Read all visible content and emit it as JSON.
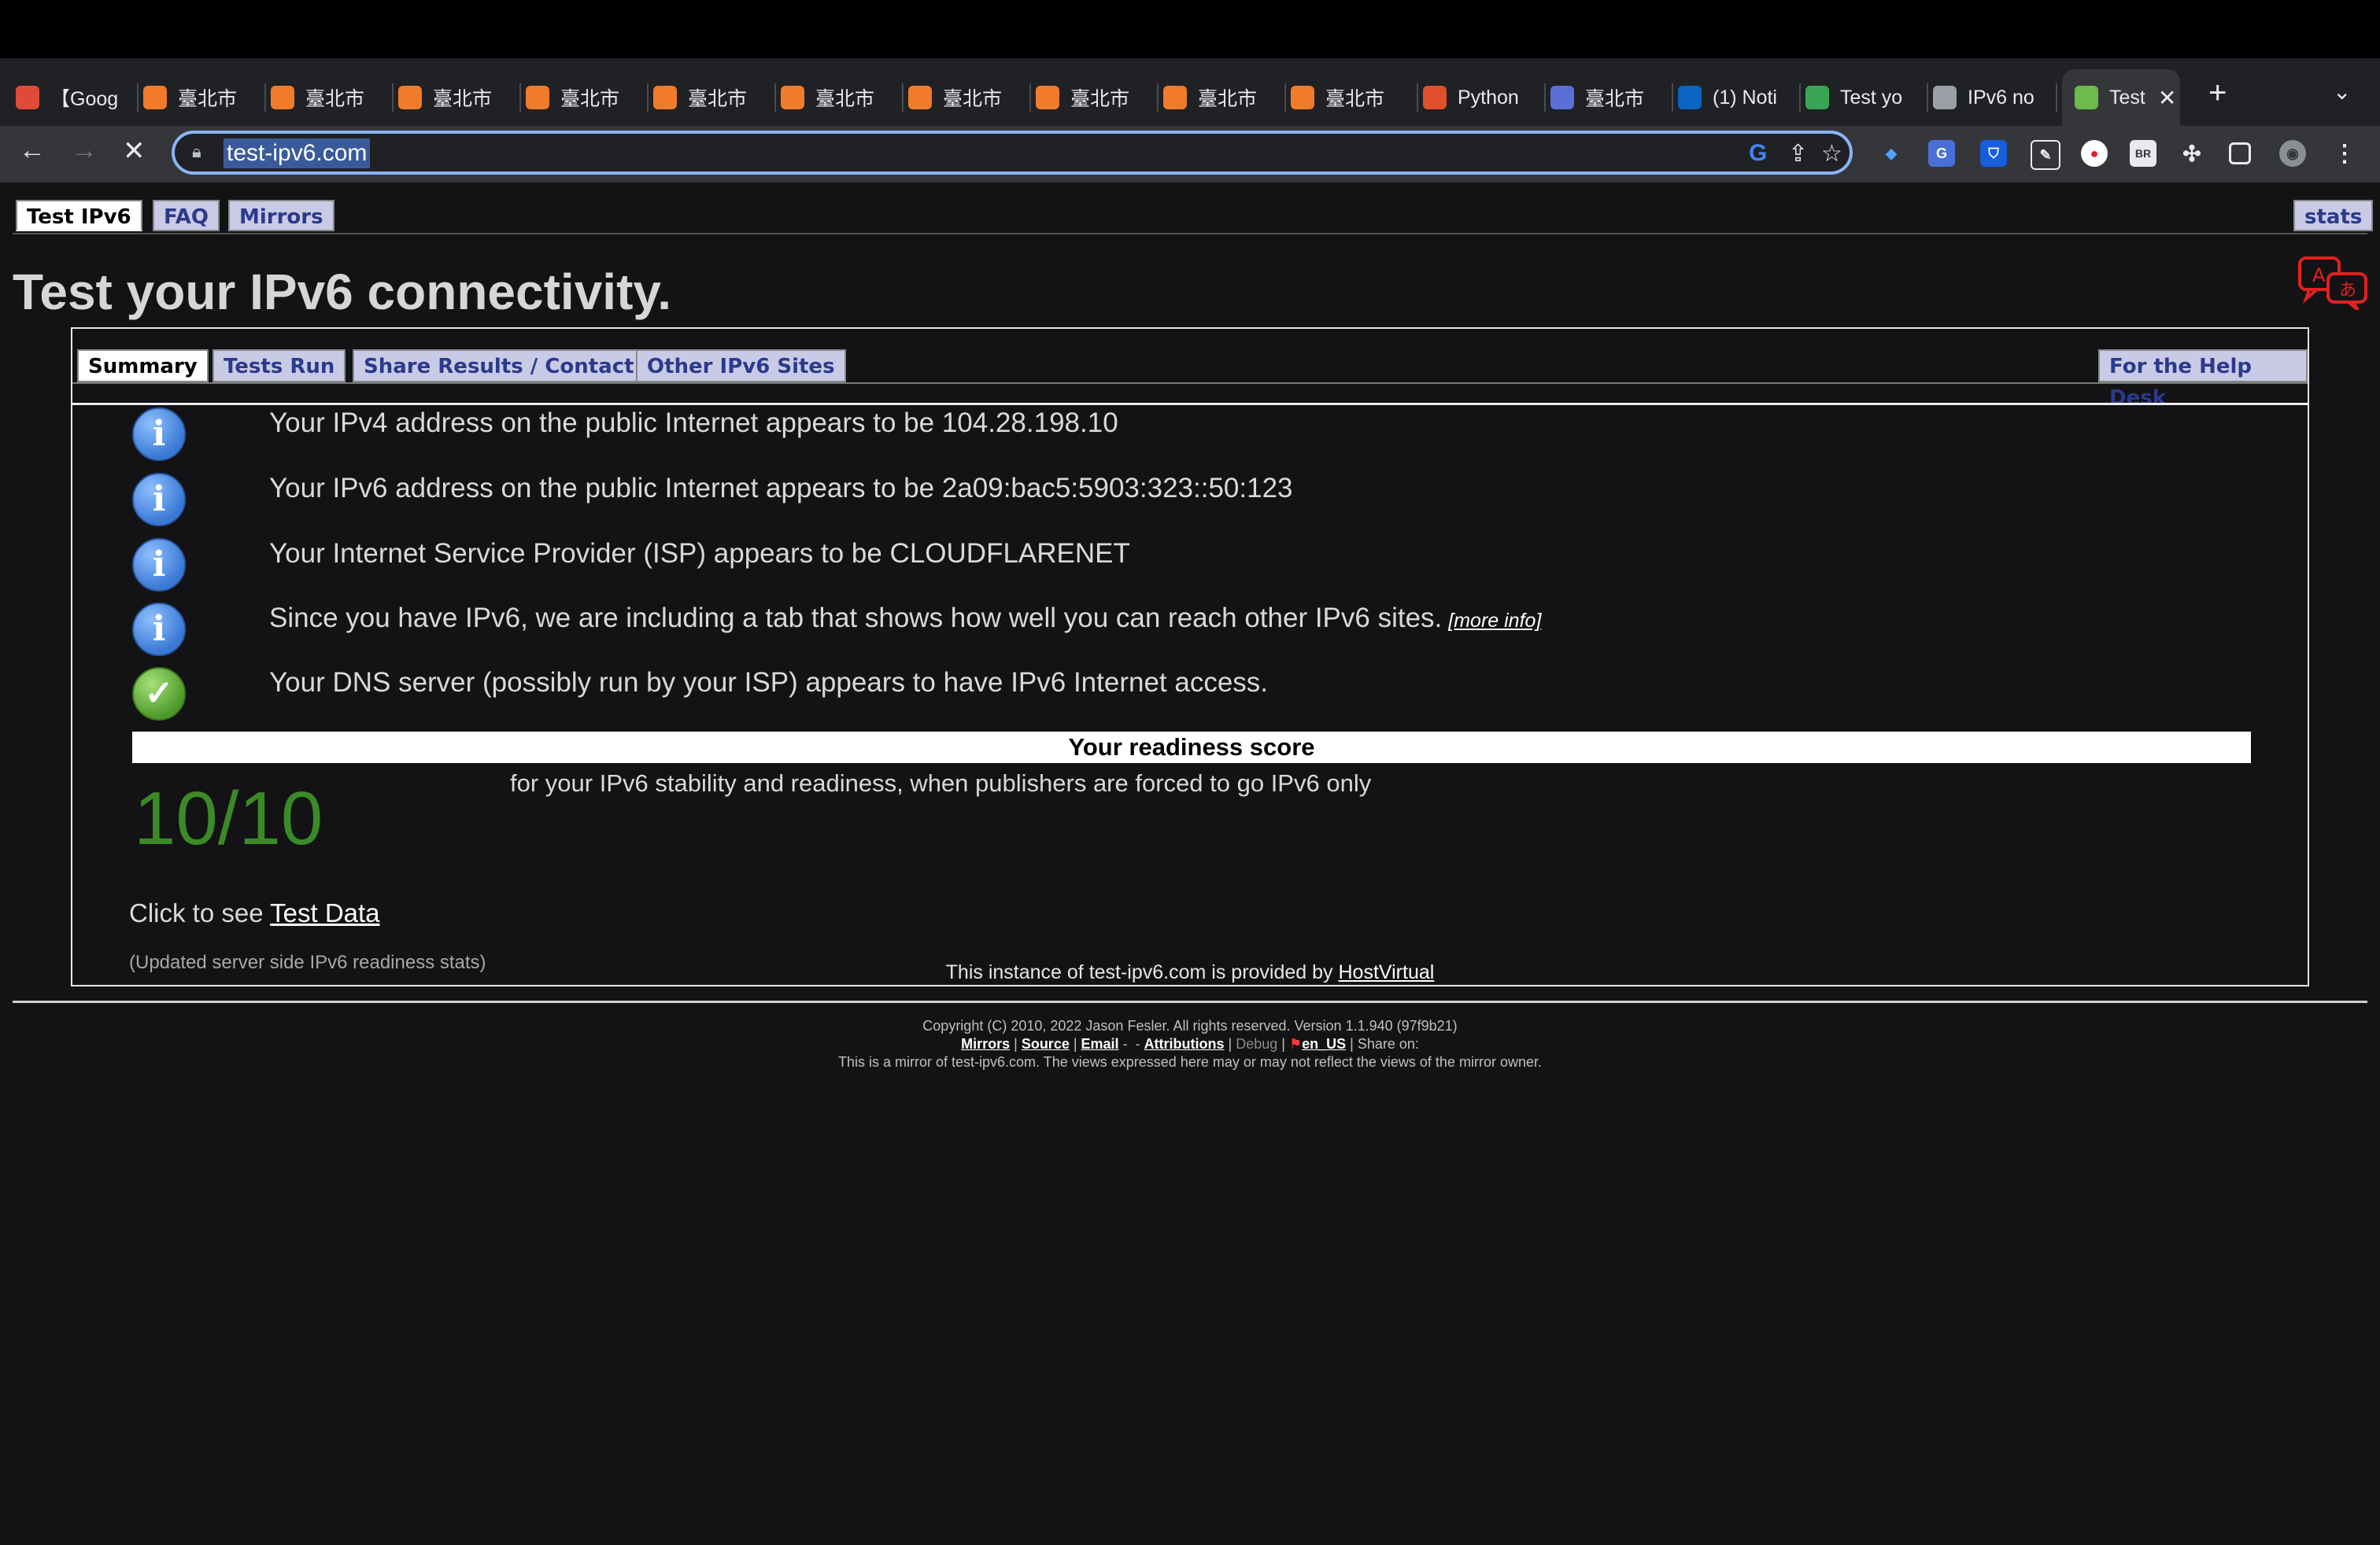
{
  "browser": {
    "tabs": [
      {
        "label": "【Goog",
        "favicon": "chrome-red-icon",
        "color": "#e04a3a"
      },
      {
        "label": "臺北市",
        "favicon": "orange-square-icon",
        "color": "#f07c2a"
      },
      {
        "label": "臺北市",
        "favicon": "orange-square-icon",
        "color": "#f07c2a"
      },
      {
        "label": "臺北市",
        "favicon": "orange-square-icon",
        "color": "#f07c2a"
      },
      {
        "label": "臺北市",
        "favicon": "orange-square-icon",
        "color": "#f07c2a"
      },
      {
        "label": "臺北市",
        "favicon": "orange-square-icon",
        "color": "#f07c2a"
      },
      {
        "label": "臺北市",
        "favicon": "orange-square-icon",
        "color": "#f07c2a"
      },
      {
        "label": "臺北市",
        "favicon": "orange-square-icon",
        "color": "#f07c2a"
      },
      {
        "label": "臺北市",
        "favicon": "orange-square-icon",
        "color": "#f07c2a"
      },
      {
        "label": "臺北市",
        "favicon": "orange-square-icon",
        "color": "#f07c2a"
      },
      {
        "label": "臺北市",
        "favicon": "orange-square-icon",
        "color": "#f07c2a"
      },
      {
        "label": "Python",
        "favicon": "paper-plane-icon",
        "color": "#e0502a"
      },
      {
        "label": "臺北市",
        "favicon": "blue-square-icon",
        "color": "#5b6fd6"
      },
      {
        "label": "(1) Noti",
        "favicon": "linkedin-icon",
        "color": "#0a66c2"
      },
      {
        "label": "Test yo",
        "favicon": "check-square-icon",
        "color": "#3aa655"
      },
      {
        "label": "IPv6 no",
        "favicon": "diamond-icon",
        "color": "#9aa0a6"
      },
      {
        "label": "Test",
        "favicon": "ipv6-check-icon",
        "color": "#6dbb4a",
        "active": true
      }
    ],
    "url": "test-ipv6.com"
  },
  "page": {
    "top_tabs": [
      "Test IPv6",
      "FAQ",
      "Mirrors"
    ],
    "stats_tab": "stats",
    "title": "Test your IPv6 connectivity.",
    "sub_tabs": [
      "Summary",
      "Tests Run",
      "Share Results / Contact",
      "Other IPv6 Sites"
    ],
    "help_desk_tab": "For the Help Desk",
    "results": [
      {
        "text": "Your IPv4 address on the public Internet appears to be 104.28.198.10",
        "icon": "info-icon"
      },
      {
        "text": "Your IPv6 address on the public Internet appears to be 2a09:bac5:5903:323::50:123",
        "icon": "info-icon"
      },
      {
        "text": "Your Internet Service Provider (ISP) appears to be CLOUDFLARENET",
        "icon": "info-icon"
      },
      {
        "text": "Since you have IPv6, we are including a tab that shows how well you can reach other IPv6 sites.",
        "icon": "info-icon",
        "link": "[more info]"
      },
      {
        "text": "Your DNS server (possibly run by your ISP) appears to have IPv6 Internet access.",
        "icon": "check-icon"
      }
    ],
    "readiness_header": "Your readiness score",
    "score": "10/10",
    "score_description": "for your IPv6 stability and readiness, when publishers are forced to go IPv6 only",
    "click_to_see": "Click to see",
    "test_data_link": "Test Data",
    "updated_stats": "(Updated server side IPv6 readiness stats)",
    "provided_by": "This instance of test-ipv6.com is provided by",
    "provider": "HostVirtual",
    "footer": {
      "copyright": "Copyright (C) 2010, 2022 Jason Fesler. All rights reserved. Version 1.1.940 (97f9b21)",
      "mirrors": "Mirrors",
      "source": "Source",
      "email": "Email",
      "attributions": "Attributions",
      "debug": "Debug",
      "locale": "en_US",
      "share_on": "Share on:",
      "mirror_note": "This is a mirror of test-ipv6.com. The views expressed here may or may not reflect the views of the mirror owner."
    }
  }
}
